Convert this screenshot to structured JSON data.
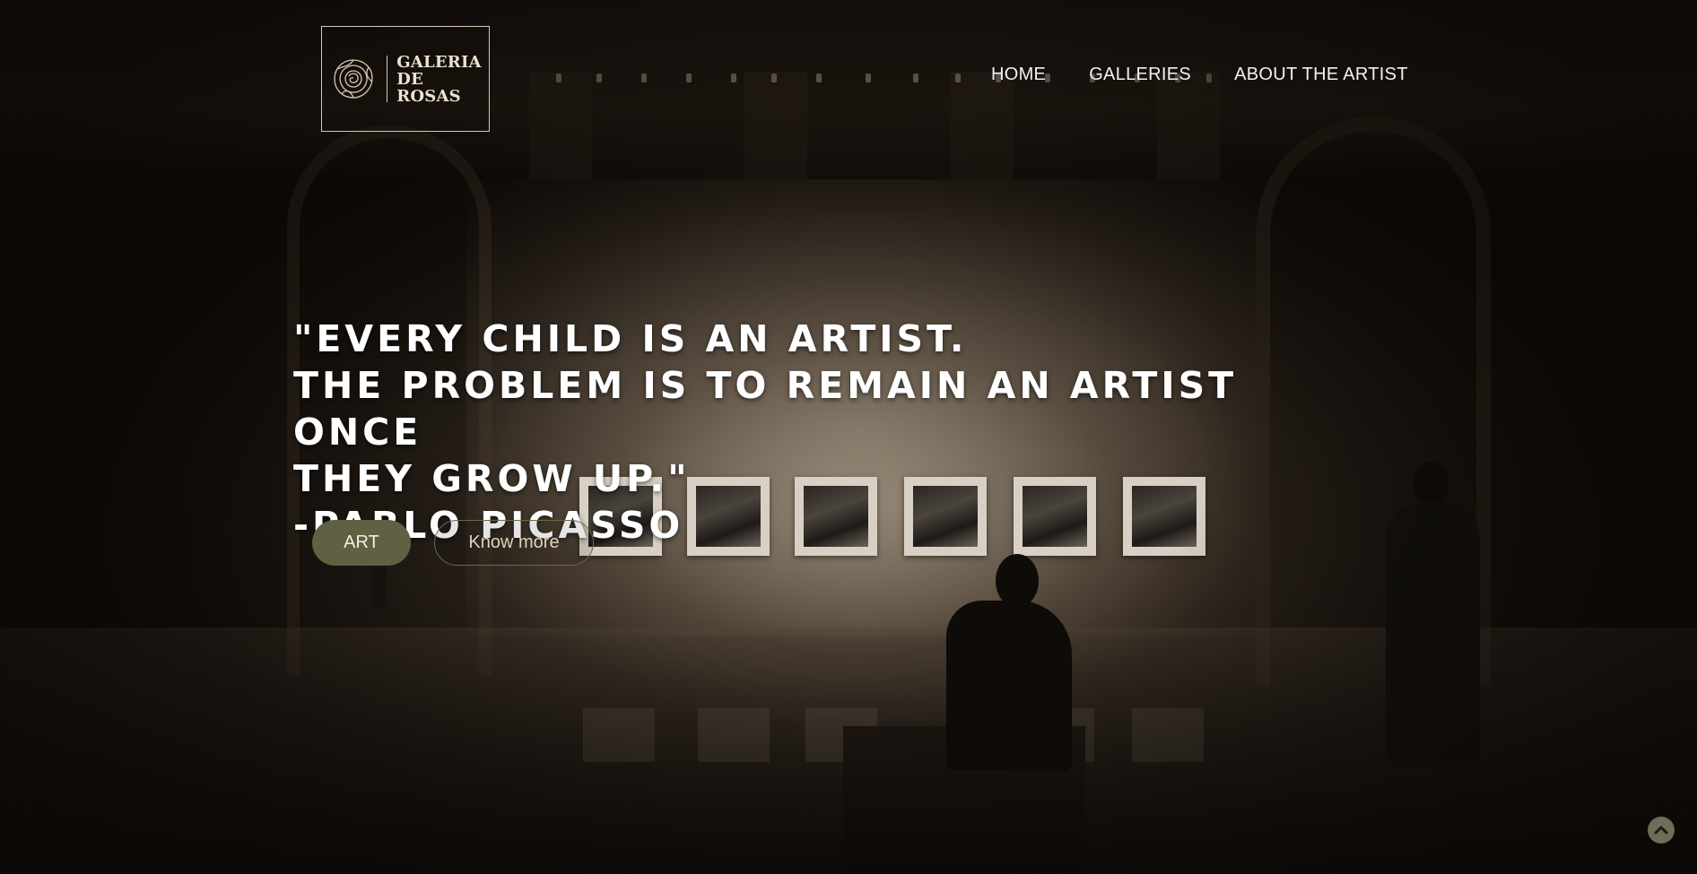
{
  "logo": {
    "line1": "GALERIA",
    "line2": "DE",
    "line3": "ROSAS"
  },
  "nav": {
    "items": [
      {
        "label": "HOME"
      },
      {
        "label": "GALLERIES"
      },
      {
        "label": "ABOUT THE ARTIST"
      }
    ]
  },
  "hero": {
    "quote_lines": [
      "\"EVERY CHILD IS AN ARTIST.",
      "THE PROBLEM IS TO REMAIN AN ARTIST ONCE",
      "THEY GROW UP.\"",
      "-PABLO PICASSO"
    ],
    "primary_button": "ART",
    "secondary_button": "Know more"
  },
  "icons": {
    "logo": "rose-icon",
    "scroll_top": "chevron-up-icon"
  },
  "colors": {
    "accent": "#5f6142",
    "outline": "#6f6a4c",
    "logo_border": "#d9c7b2",
    "scroll_button": "#6d6d58"
  }
}
